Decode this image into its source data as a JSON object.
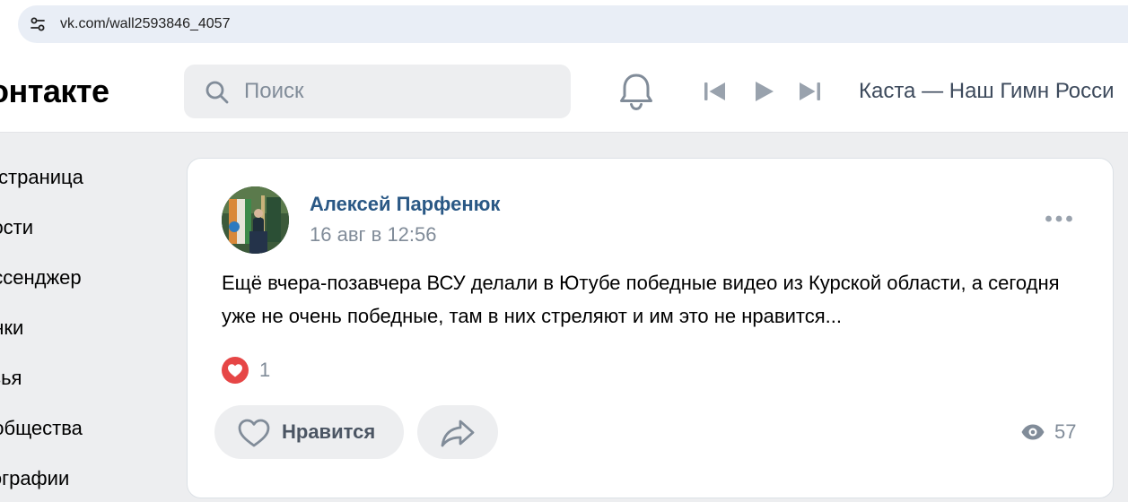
{
  "browser": {
    "url": "vk.com/wall2593846_4057",
    "site_info_icon": "tune-icon"
  },
  "header": {
    "logo": "онтакте",
    "search_placeholder": "Поиск",
    "search_icon": "search-icon",
    "notifications_icon": "bell-icon",
    "player": {
      "prev_icon": "skip-previous-icon",
      "play_icon": "play-icon",
      "next_icon": "skip-next-icon",
      "track": "Каста — Наш Гимн Росси"
    }
  },
  "nav": {
    "items": [
      {
        "label": "я страница"
      },
      {
        "label": "вости"
      },
      {
        "label": "ессенджер"
      },
      {
        "label": "онки"
      },
      {
        "label": "узья"
      },
      {
        "label": "ообщества"
      },
      {
        "label": "тографии"
      }
    ]
  },
  "post": {
    "author": "Алексей Парфенюк",
    "date": "16 авг в 12:56",
    "text": "Ещё вчера-позавчера ВСУ делали в Ютубе победные видео из Курской области, а сегодня уже не очень победные, там в них стреляют и им это не нравится...",
    "reaction_count": "1",
    "like_label": "Нравится",
    "views": "57",
    "colors": {
      "author": "#2a5885",
      "reaction": "#e64646"
    }
  }
}
